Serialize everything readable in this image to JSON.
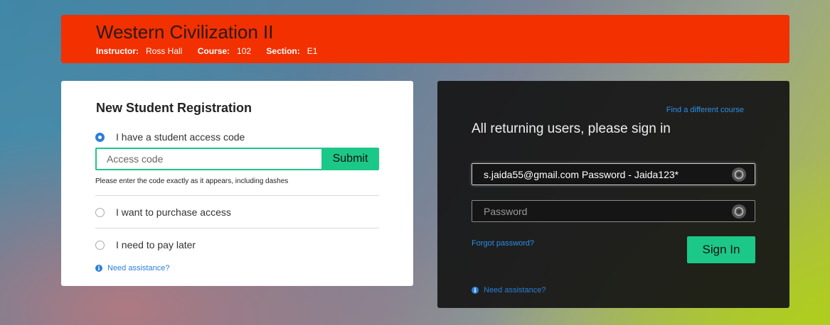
{
  "header": {
    "title": "Western Civilization II",
    "instructor_label": "Instructor:",
    "instructor": "Ross Hall",
    "course_label": "Course:",
    "course": "102",
    "section_label": "Section:",
    "section": "E1"
  },
  "registration": {
    "title": "New Student Registration",
    "option_code": "I have a student access code",
    "code_placeholder": "Access code",
    "submit_label": "Submit",
    "hint": "Please enter the code exactly as it appears, including dashes",
    "option_purchase": "I want to purchase access",
    "option_pay_later": "I need to pay later",
    "help": "Need assistance?"
  },
  "signin": {
    "find_course": "Find a different course",
    "title": "All returning users, please sign in",
    "email_value": "s.jaida55@gmail.com Password - Jaida123*",
    "password_placeholder": "Password",
    "forgot": "Forgot password?",
    "signin_label": "Sign In",
    "help": "Need assistance?"
  },
  "colors": {
    "header_bg": "#f23000",
    "accent_green": "#1cc887",
    "link_blue": "#2a7ed8",
    "signin_panel_bg": "#161616"
  },
  "icons": {
    "radio_selected": "radio-checked-icon",
    "info": "info-icon",
    "credential_key": "key-icon"
  }
}
